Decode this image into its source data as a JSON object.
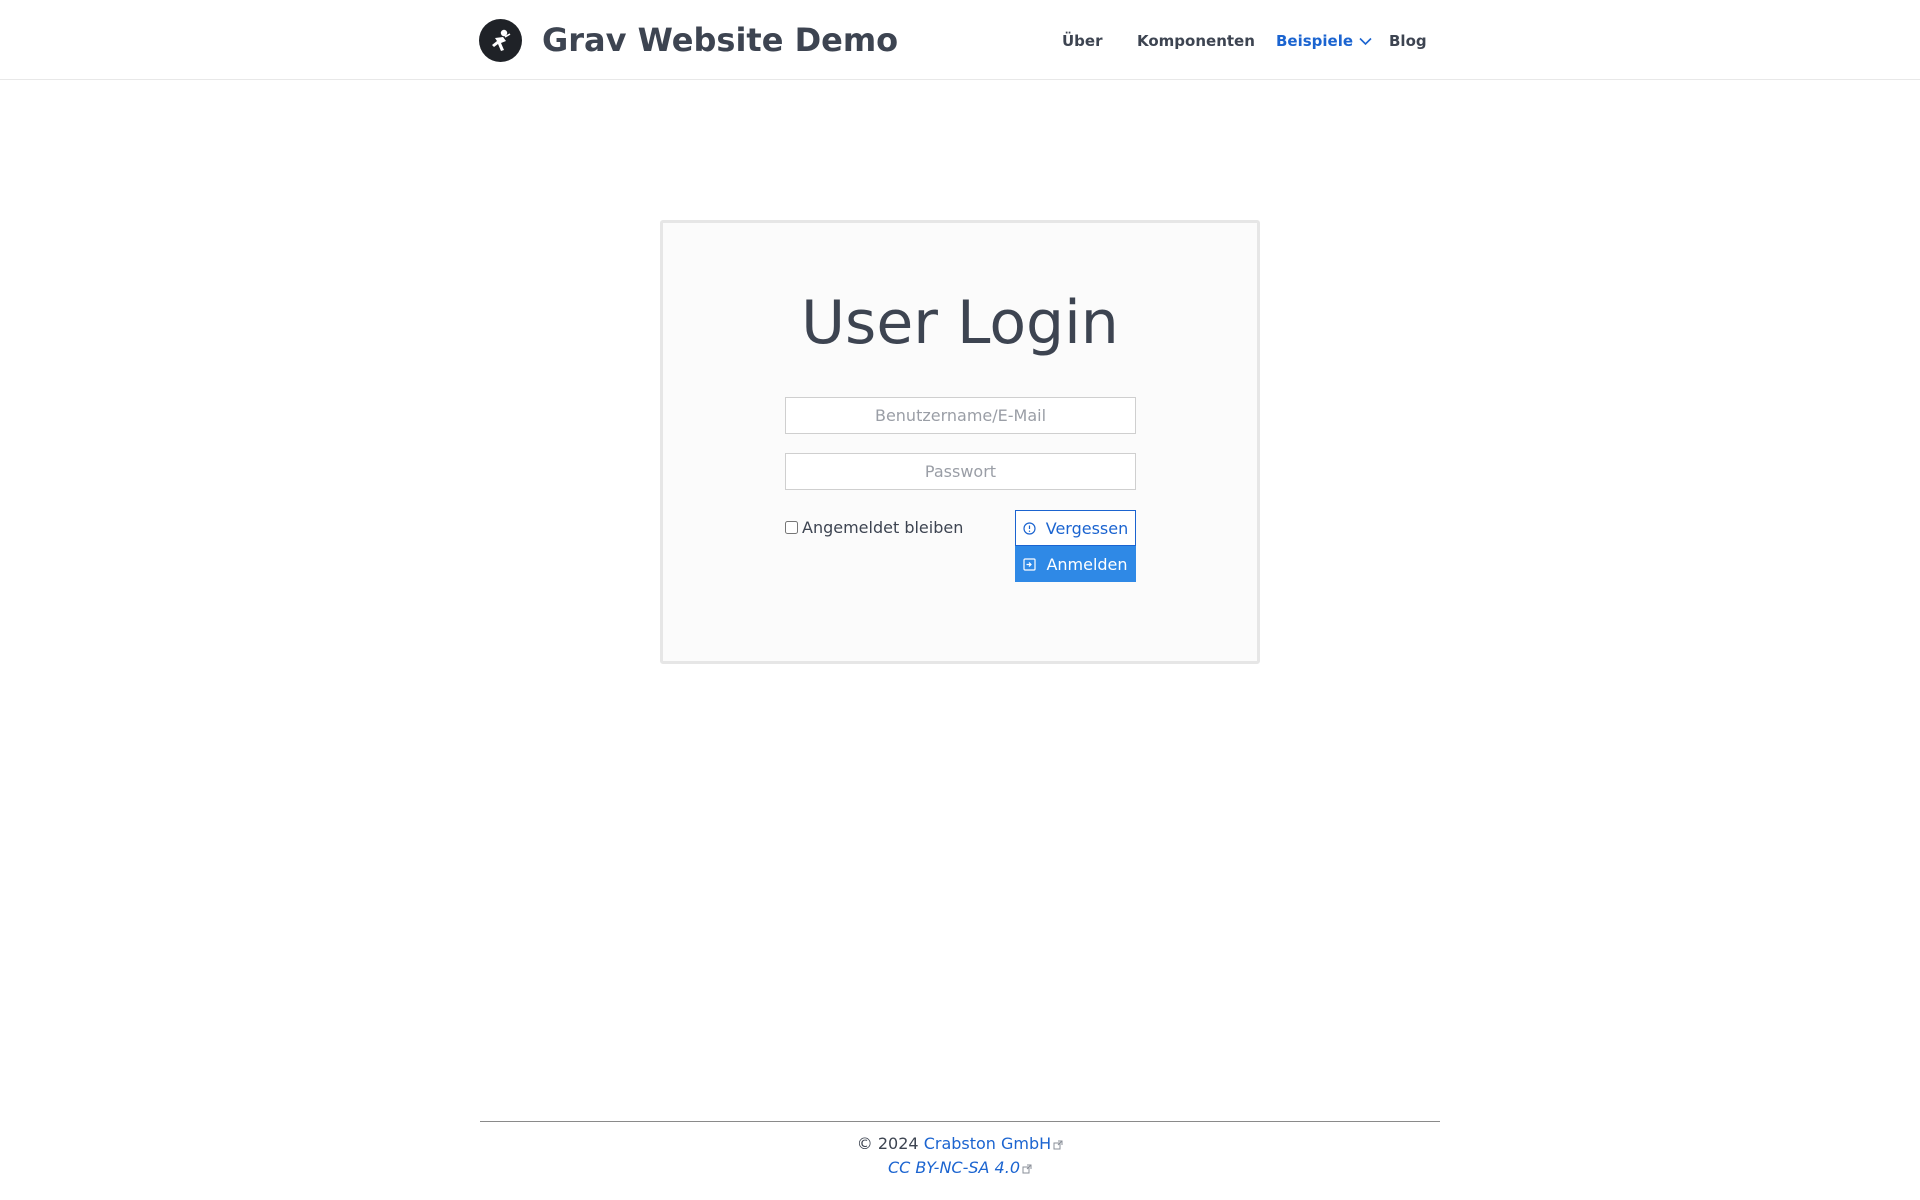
{
  "header": {
    "site_title": "Grav Website Demo",
    "logo_icon": "astronaut-logo-icon",
    "nav": [
      {
        "label": "Über"
      },
      {
        "label": "Komponenten"
      },
      {
        "label": "Beispiele",
        "active": true,
        "icon": "chevron-down-icon"
      },
      {
        "label": "Blog"
      }
    ]
  },
  "login": {
    "title": "User Login",
    "username_placeholder": "Benutzername/E-Mail",
    "username_value": "",
    "password_placeholder": "Passwort",
    "password_value": "",
    "remember_label": "Angemeldet bleiben",
    "remember_checked": false,
    "forgot_label": "Vergessen",
    "forgot_icon": "info-circle-icon",
    "submit_label": "Anmelden",
    "submit_icon": "login-icon"
  },
  "footer": {
    "copyright": "© 2024",
    "company_link": "Crabston GmbH",
    "license_link": "CC BY-NC-SA 4.0",
    "external_icon": "external-link-icon"
  },
  "colors": {
    "accent": "#1b64d0",
    "button_primary": "#2f89e6",
    "text": "#3d4451",
    "panel_bg": "#fbfbfb"
  }
}
